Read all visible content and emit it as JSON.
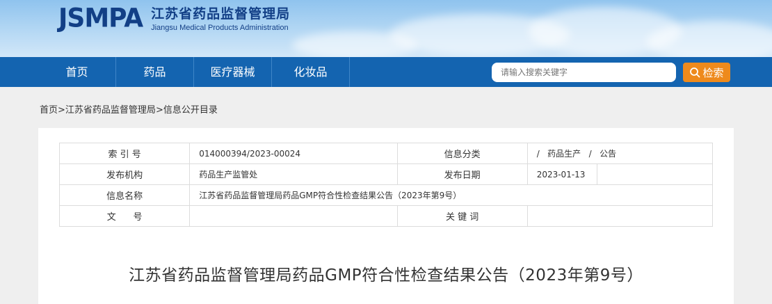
{
  "site": {
    "logo_mark": "JSMPA",
    "name_cn": "江苏省药品监督管理局",
    "name_en": "Jiangsu Medical Products Administration"
  },
  "nav": {
    "items": [
      {
        "label": "首页"
      },
      {
        "label": "药品"
      },
      {
        "label": "医疗器械"
      },
      {
        "label": "化妆品"
      }
    ],
    "search_placeholder": "请输入搜索关键字",
    "search_button": "检索"
  },
  "breadcrumb": [
    "首页",
    "江苏省药品监督管理局",
    "信息公开目录"
  ],
  "breadcrumb_sep": ">",
  "meta": {
    "index_label": "索 引 号",
    "index_value": "014000394/2023-00024",
    "category_label": "信息分类",
    "category_value": "/   药品生产   /   公告",
    "publisher_label": "发布机构",
    "publisher_value": "药品生产监管处",
    "date_label": "发布日期",
    "date_value": "2023-01-13",
    "name_label": "信息名称",
    "name_value": "江苏省药品监督管理局药品GMP符合性检查结果公告（2023年第9号）",
    "docno_label": "文      号",
    "docno_value": "",
    "keywords_label": "关 键 词",
    "keywords_value": ""
  },
  "article": {
    "title": "江苏省药品监督管理局药品GMP符合性检查结果公告（2023年第9号）"
  },
  "colors": {
    "nav_bg": "#1464b0",
    "search_button_bg": "#ee8a1c",
    "logo_color": "#123f86"
  }
}
